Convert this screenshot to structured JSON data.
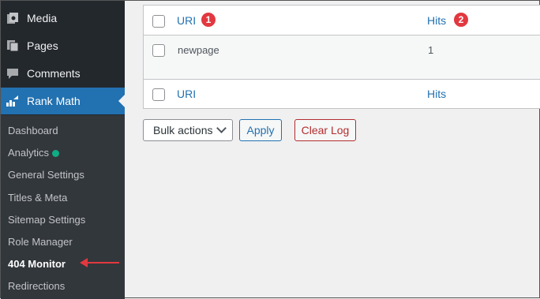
{
  "sidebar": {
    "menu": [
      {
        "label": "Media",
        "icon": "media-icon"
      },
      {
        "label": "Pages",
        "icon": "pages-icon"
      },
      {
        "label": "Comments",
        "icon": "comments-icon"
      },
      {
        "label": "Rank Math",
        "icon": "rank-math-icon",
        "active": true
      }
    ],
    "submenu": [
      {
        "label": "Dashboard"
      },
      {
        "label": "Analytics",
        "status_dot": "#10ac84"
      },
      {
        "label": "General Settings"
      },
      {
        "label": "Titles & Meta"
      },
      {
        "label": "Sitemap Settings"
      },
      {
        "label": "Role Manager"
      },
      {
        "label": "404 Monitor",
        "current": true
      },
      {
        "label": "Redirections"
      }
    ]
  },
  "table": {
    "header": {
      "uri": "URI",
      "hits": "Hits",
      "uri_badge": "1",
      "hits_badge": "2"
    },
    "rows": [
      {
        "uri": "newpage",
        "hits": "1"
      }
    ],
    "footer": {
      "uri": "URI",
      "hits": "Hits"
    }
  },
  "actions": {
    "bulk_select": "Bulk actions",
    "apply": "Apply",
    "clear_log": "Clear Log"
  },
  "colors": {
    "sidebar_bg": "#23282d",
    "submenu_bg": "#32373c",
    "active_bg": "#2271b1",
    "link": "#2271b1",
    "danger": "#b32d2e",
    "annotation": "#e2383f"
  }
}
